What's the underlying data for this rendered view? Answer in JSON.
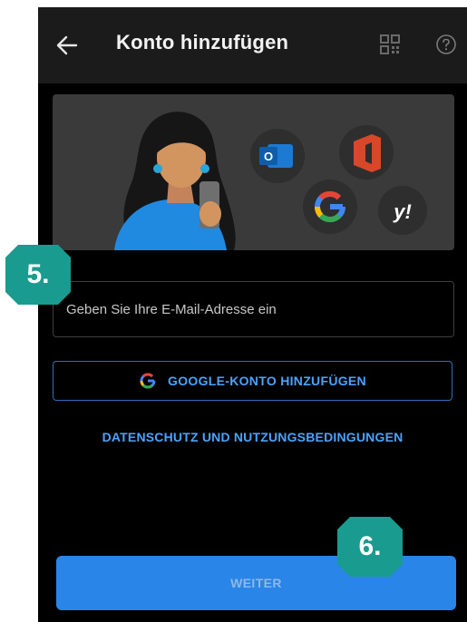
{
  "header": {
    "title": "Konto hinzufügen",
    "back_icon": "arrow-left-icon",
    "qr_icon": "qr-code-icon",
    "help_icon": "help-circle-icon"
  },
  "hero": {
    "icons": [
      "outlook-icon",
      "office-icon",
      "google-icon",
      "yahoo-icon"
    ],
    "yahoo_text": "y!"
  },
  "email": {
    "placeholder": "Geben Sie Ihre E-Mail-Adresse ein",
    "value": ""
  },
  "google_button": {
    "label": "GOOGLE-KONTO HINZUFÜGEN",
    "icon": "google-g-icon"
  },
  "privacy_link": "DATENSCHUTZ UND NUTZUNGSBEDINGUNGEN",
  "next_button": "WEITER",
  "annotations": {
    "step5": "5.",
    "step6": "6.",
    "color": "#1a9b8f"
  },
  "colors": {
    "accent": "#4aa3ff",
    "primary_button": "#2a85e8",
    "background": "#000000",
    "appbar": "#1b1b1b"
  }
}
